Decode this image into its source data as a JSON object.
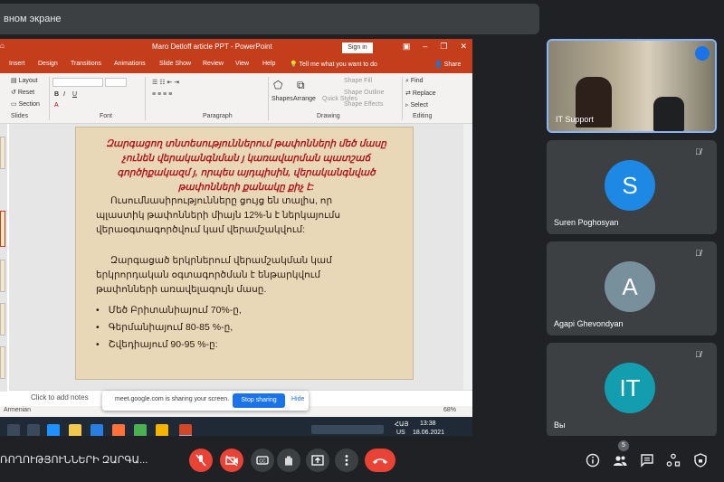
{
  "banner": {
    "text": "вном экране"
  },
  "powerpoint": {
    "title": "Maro Detloff article PPT  -  PowerPoint",
    "signin": "Sign in",
    "tabs": [
      "Insert",
      "Design",
      "Transitions",
      "Animations",
      "Slide Show",
      "Review",
      "View",
      "Help"
    ],
    "tell_me": "Tell me what you want to do",
    "share": "Share",
    "ribbon": {
      "layout": "Layout",
      "reset": "Reset",
      "section": "Section",
      "slides": "Slides",
      "font": "Font",
      "paragraph": "Paragraph",
      "shapes": "Shapes",
      "arrange": "Arrange",
      "quick_styles": "Quick Styles",
      "shape_fill": "Shape Fill",
      "shape_outline": "Shape Outline",
      "shape_effects": "Shape Effects",
      "drawing": "Drawing",
      "find": "Find",
      "replace": "Replace",
      "select": "Select",
      "editing": "Editing"
    },
    "slide": {
      "title": "Զարգացող տնտեսություններում թափոնների մեծ մասը չունեն վերականգնման յ կառավարման պատշաճ գործիքակազմ յ, որպես այդպիսին, վերականգնված թափոնների քանակը քիչ է:",
      "para1": "Ուսումնասիրությունները ցույց են տալիս, որ պլաստիկ թափոնների միայն 12%-ն է ներկայումս վերաօգտագործվում կամ վերամշակվում:",
      "para2": "Զարգացած երկրներում վերամշակման կամ երկրորդական օգտագործման է ենթարկվում թափոնների առավելագույն մասը.",
      "bullets": [
        "Մեծ Բրիտանիայում  70%-ը,",
        "Գերմանիայում  80-85 %-ը,",
        "Շվեդիայում  90-95 %-ը:"
      ]
    },
    "notes_placeholder": "Click to add notes",
    "status_lang": "Armenian",
    "zoom": "68%"
  },
  "share_notice": {
    "message": "meet.google.com is sharing your screen.",
    "stop": "Stop sharing",
    "hide": "Hide"
  },
  "taskbar": {
    "lang": "ՀԱՅ",
    "lang2": "US",
    "time": "13:38",
    "date": "18.06.2021"
  },
  "participants": [
    {
      "name": "IT Support",
      "type": "video"
    },
    {
      "name": "Suren Poghosyan",
      "initial": "S",
      "color": "#1e88e5"
    },
    {
      "name": "Agapi Ghevondyan",
      "initial": "A",
      "color": "#78909c"
    },
    {
      "name": "Вы",
      "initial": "IT",
      "color": "#129eaf"
    }
  ],
  "meeting": {
    "title": "ՌՈՂՈՒԹՅՈՒՆՆԵՐԻ ԶԱՐԳԱ...",
    "people_count": "5"
  },
  "colors": {
    "ppt_red": "#c43e1c",
    "meet_bg": "#202124",
    "tile_bg": "#3c4043",
    "danger": "#ea4335",
    "accent": "#1a73e8"
  }
}
